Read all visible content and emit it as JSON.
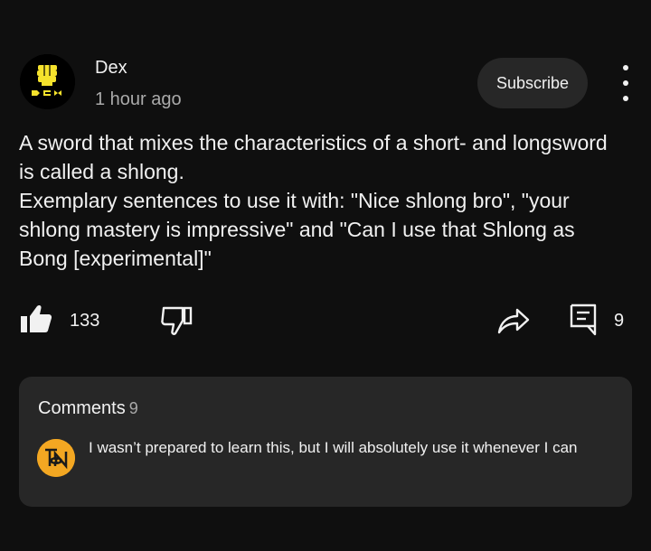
{
  "post": {
    "channel_name": "Dex",
    "time": "1 hour ago",
    "subscribe_label": "Subscribe",
    "body_line1": "A sword that mixes the characteristics of a short- and longsword is called a shlong.",
    "body_line2": "Exemplary sentences to use it with: \"Nice shlong bro\", \"your shlong mastery is impressive\" and \"Can I use that Shlong as Bong [experimental]\"",
    "likes": "133",
    "comments_count": "9"
  },
  "comments": {
    "title": "Comments",
    "count": "9",
    "top_comment": "I wasn’t prepared to learn this, but I will absolutely use it whenever I can"
  },
  "icons": {
    "avatar": "fist-logo-avatar",
    "like": "thumbs-up-filled-icon",
    "dislike": "thumbs-down-outline-icon",
    "share": "share-arrow-icon",
    "comment": "comment-icon",
    "more": "vertical-dots-icon"
  },
  "colors": {
    "background": "#0f0f0f",
    "card": "#272727",
    "text": "#f1f1f1",
    "secondary_text": "#aaaaaa",
    "avatar_yellow": "#f5e22c",
    "comment_avatar_orange": "#f3a722"
  }
}
